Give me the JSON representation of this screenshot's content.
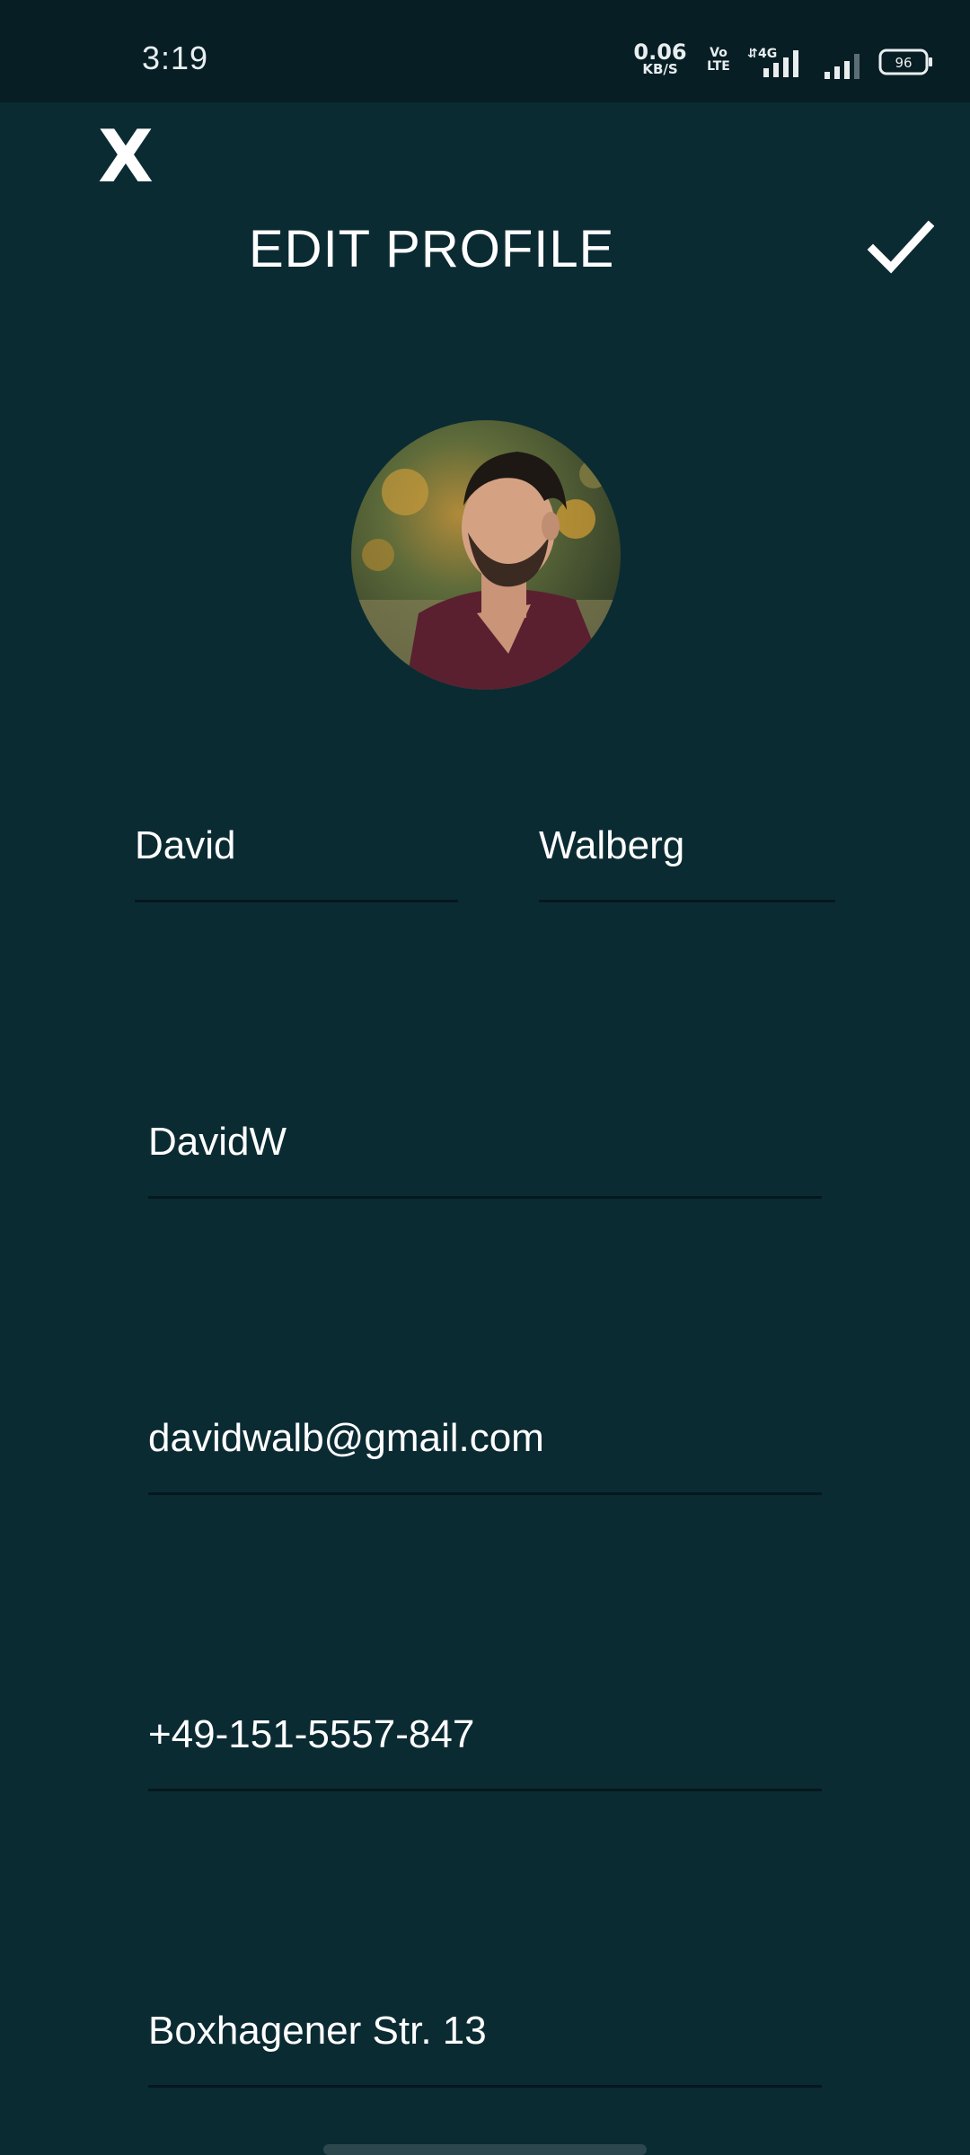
{
  "status_bar": {
    "time": "3:19",
    "net_speed_value": "0.06",
    "net_speed_unit": "KB/S",
    "volte_top": "Vo",
    "volte_bottom": "LTE",
    "network": "4G",
    "battery": "96",
    "icons": [
      "signal-4g-icon",
      "signal-icon",
      "battery-icon"
    ]
  },
  "header": {
    "close_label": "X",
    "title": "EDIT PROFILE",
    "confirm_icon": "check-icon"
  },
  "profile": {
    "avatar": "profile-photo",
    "first_name": "David",
    "last_name": "Walberg",
    "username": "DavidW",
    "email": "davidwalb@gmail.com",
    "phone": "+49-151-5557-847",
    "address": "Boxhagener Str. 13"
  },
  "colors": {
    "background": "#0b2b33",
    "status_bar": "#071e24",
    "text": "#ffffff",
    "underline": "#05181d"
  }
}
